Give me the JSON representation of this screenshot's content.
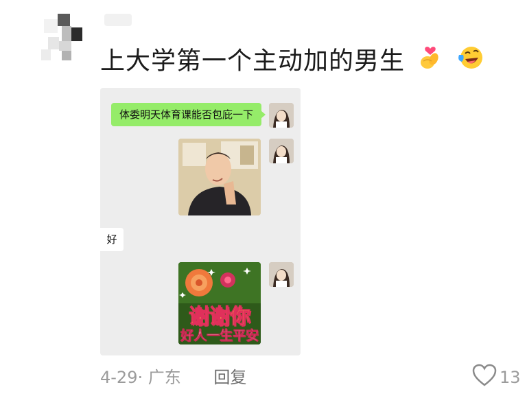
{
  "comment": {
    "text": "上大学第一个主动加的男生",
    "emojis": [
      "pinched-heart-fingers-icon",
      "laughing-crying-emoji-icon"
    ]
  },
  "chat": {
    "message_sent": "体委明天体育课能否包庇一下",
    "reply_received": "好",
    "sticker_thanks": {
      "line1": "谢谢你",
      "line2": "好人一生平安"
    }
  },
  "footer": {
    "meta": "4-29· 广东",
    "reply_label": "回复",
    "like_count": "13"
  },
  "colors": {
    "bubble_green": "#95ec69",
    "chat_bg": "#ededed",
    "meta_text": "#9b9b9b"
  }
}
